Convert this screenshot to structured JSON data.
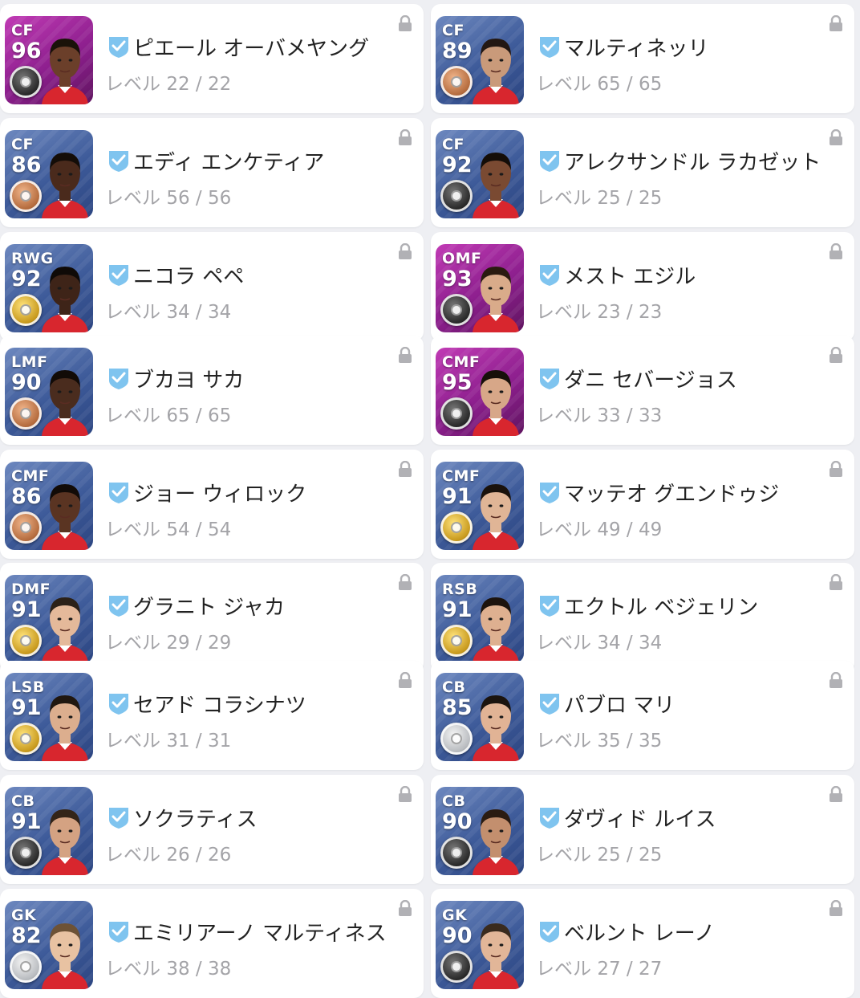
{
  "level_prefix": "レベル",
  "players": [
    {
      "pos": "CF",
      "ovr": "96",
      "name": "ピエール オーバメヤング",
      "level": "22 / 22",
      "coin": "black",
      "featured": true
    },
    {
      "pos": "CF",
      "ovr": "89",
      "name": "マルティネッリ",
      "level": "65 / 65",
      "coin": "bronze",
      "featured": false
    },
    {
      "pos": "CF",
      "ovr": "86",
      "name": "エディ エンケティア",
      "level": "56 / 56",
      "coin": "bronze",
      "featured": false
    },
    {
      "pos": "CF",
      "ovr": "92",
      "name": "アレクサンドル ラカゼット",
      "level": "25 / 25",
      "coin": "black",
      "featured": false
    },
    {
      "pos": "RWG",
      "ovr": "92",
      "name": "ニコラ ペペ",
      "level": "34 / 34",
      "coin": "gold",
      "featured": false
    },
    {
      "pos": "OMF",
      "ovr": "93",
      "name": "メスト エジル",
      "level": "23 / 23",
      "coin": "black",
      "featured": true
    },
    {
      "pos": "LMF",
      "ovr": "90",
      "name": "ブカヨ サカ",
      "level": "65 / 65",
      "coin": "bronze",
      "featured": false
    },
    {
      "pos": "CMF",
      "ovr": "95",
      "name": "ダニ セバージョス",
      "level": "33 / 33",
      "coin": "black",
      "featured": true
    },
    {
      "pos": "CMF",
      "ovr": "86",
      "name": "ジョー ウィロック",
      "level": "54 / 54",
      "coin": "bronze",
      "featured": false
    },
    {
      "pos": "CMF",
      "ovr": "91",
      "name": "マッテオ グエンドゥジ",
      "level": "49 / 49",
      "coin": "gold",
      "featured": false
    },
    {
      "pos": "DMF",
      "ovr": "91",
      "name": "グラニト ジャカ",
      "level": "29 / 29",
      "coin": "gold",
      "featured": false
    },
    {
      "pos": "RSB",
      "ovr": "91",
      "name": "エクトル ベジェリン",
      "level": "34 / 34",
      "coin": "gold",
      "featured": false
    },
    {
      "pos": "LSB",
      "ovr": "91",
      "name": "セアド コラシナツ",
      "level": "31 / 31",
      "coin": "gold",
      "featured": false
    },
    {
      "pos": "CB",
      "ovr": "85",
      "name": "パブロ マリ",
      "level": "35 / 35",
      "coin": "silver",
      "featured": false
    },
    {
      "pos": "CB",
      "ovr": "91",
      "name": "ソクラティス",
      "level": "26 / 26",
      "coin": "black",
      "featured": false
    },
    {
      "pos": "CB",
      "ovr": "90",
      "name": "ダヴィド ルイス",
      "level": "25 / 25",
      "coin": "black",
      "featured": false
    },
    {
      "pos": "GK",
      "ovr": "82",
      "name": "エミリアーノ マルティネス",
      "level": "38 / 38",
      "coin": "silver",
      "featured": false
    },
    {
      "pos": "GK",
      "ovr": "90",
      "name": "ベルント レーノ",
      "level": "27 / 27",
      "coin": "black",
      "featured": false
    }
  ],
  "icons": {
    "lock": "lock-icon",
    "verified": "verified-check-icon",
    "coin": "player-coin-icon"
  },
  "colors": {
    "background": "#eeeff3",
    "card": "#ffffff",
    "check": "#7fc4ef",
    "standard_card": "#4a67a6",
    "featured_card": "#a52aa2",
    "level_text": "#a4a4a8"
  }
}
